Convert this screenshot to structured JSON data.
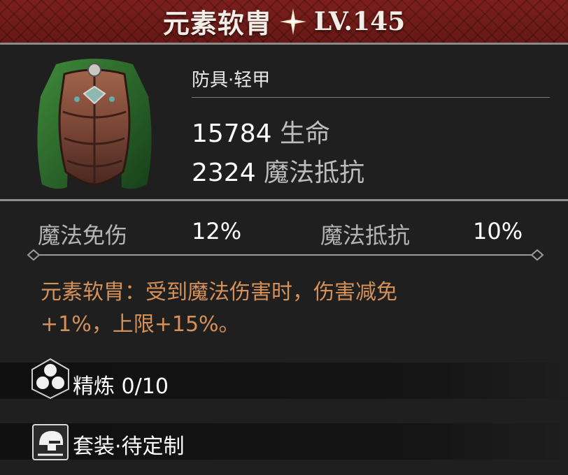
{
  "header": {
    "item_name": "元素软胄",
    "level": "LV.145",
    "accent_color": "#7b1f1d"
  },
  "item": {
    "type": "防具·轻甲",
    "icon": "cloaked-light-armor-icon",
    "primary_stats": [
      {
        "value": "15784",
        "label": "生命"
      },
      {
        "value": "2324",
        "label": "魔法抵抗"
      }
    ]
  },
  "secondary_stats": [
    {
      "label": "魔法免伤",
      "value": "12%"
    },
    {
      "label": "魔法抵抗",
      "value": "10%"
    }
  ],
  "effect": {
    "line1": "元素软胄：受到魔法伤害时，伤害减免",
    "line2": "+1%，上限+15%。",
    "color": "#d4915a"
  },
  "refine": {
    "icon": "hexagon-cluster-icon",
    "text": "精炼 0/10"
  },
  "set_bonus": {
    "icon": "helmet-icon",
    "text": "套装·待定制"
  }
}
